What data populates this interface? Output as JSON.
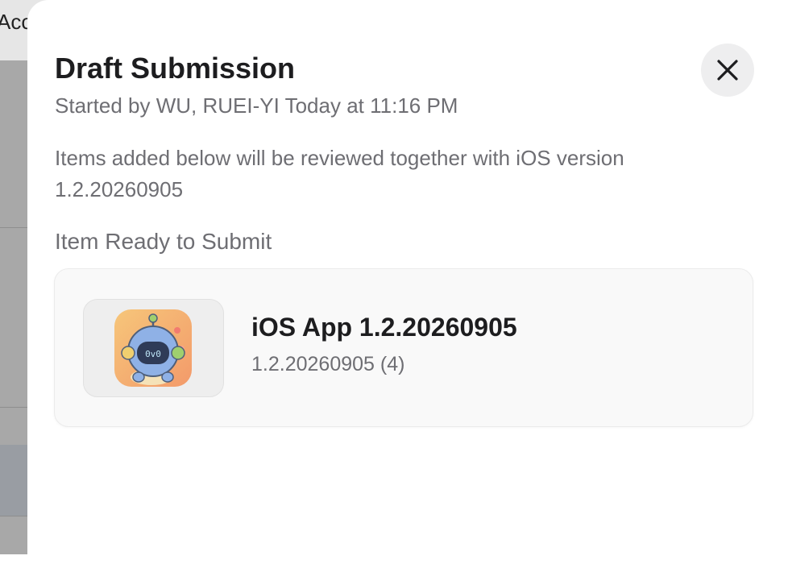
{
  "background": {
    "topbar_text": "Acce"
  },
  "modal": {
    "title": "Draft Submission",
    "subtitle": "Started by WU, RUEI-YI Today at 11:16 PM",
    "description": "Items added below will be reviewed together with iOS version 1.2.20260905",
    "close_icon": "close-icon",
    "section_heading": "Item Ready to Submit",
    "item": {
      "icon": "app-icon-robot",
      "title": "iOS App 1.2.20260905",
      "subtitle": "1.2.20260905 (4)"
    }
  },
  "colors": {
    "backdrop": "#a8a8a8",
    "modal_bg": "#ffffff",
    "primary_text": "#1d1d1f",
    "secondary_text": "#6e6e73",
    "card_bg": "#f9f9f9",
    "close_button_bg": "#eeeeef"
  }
}
